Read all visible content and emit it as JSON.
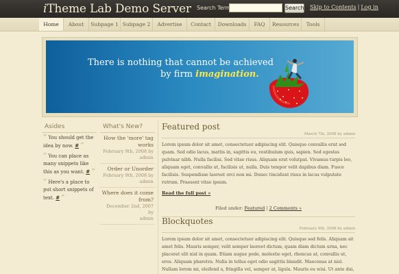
{
  "header": {
    "title_i": "i",
    "title_rest": "Theme Lab Demo Server",
    "search_label": "Search Terms:",
    "search_value": "",
    "search_button": "Search",
    "skip_link": "Skip to Contents",
    "separator": "|",
    "login_link": "Log in"
  },
  "nav": {
    "items": [
      "Home",
      "About",
      "Subpage 1",
      "Subpage 2",
      "Advertise",
      "Contact",
      "Downloads",
      "FAQ",
      "Resources",
      "Tools"
    ]
  },
  "banner": {
    "line1": "There is nothing that cannot be achieved",
    "line2_prefix": "by firm",
    "line2_highlight": "imagination."
  },
  "asides": {
    "title": "Asides",
    "items": [
      {
        "text": "You should get the idea by now.",
        "link": "#"
      },
      {
        "text": "You can place as many snippets like this as you want.",
        "link": "#"
      },
      {
        "text": "Here's a place to put short snippets of text.",
        "link": "#"
      }
    ]
  },
  "whats_new": {
    "title": "What's New?",
    "items": [
      {
        "title": "How the 'more' tag works",
        "date": "February 9th, 2008 by",
        "author": "admin"
      },
      {
        "title": "Order or Unorder",
        "date": "February 9th, 2008 by",
        "author": "admin"
      },
      {
        "title": "Where does it come from?",
        "date": "December 2nd, 2007 by",
        "author": "admin"
      }
    ]
  },
  "posts": [
    {
      "title": "Featured post",
      "date": "March 7th, 2008 by admin",
      "body": "Lorem ipsum dolor sit amet, consectetuer adipiscing elit. Quisque convallis erat sed quam. Sed odio lacus, mattis in, sagittis eu, vestibulum quis, sapien. Sed egestas pulvinar nibh. Nulla facilisi. Sed vitae risus. Aliquam erat volutpat. Vivamus turpis leo, aliquam eget, convallis ut, facilisis ut, nulla. Duis tempor velit dapibus diam. Fusce facilisis. Suspendisse laoreet orci non mi. Donec tincidunt risus in lacus vulputate rutrum. Praesent vitae ipsum.",
      "read_more": "Read the full post »",
      "filed_under": "Filed under:",
      "category": "Featured",
      "comments": "2 Comments »"
    },
    {
      "title": "Blockquotes",
      "date": "February 9th, 2008 by admin",
      "body": "Lorem ipsum dolor sit amet, consectetuer adipiscing elit. Quisque sed felis. Aliquam sit amet felis. Mauris semper, velit semper laoreet dictum, quam diam dictum urna, nec placerat elit nisl in quam. Etiam augue pede, molestie eget, rhoncus at, convallis ut, eros. Aliquam pharetra. Nulla in tellus eget odio sagittis blandit. Maecenas at nisl. Nullam lorem mi, eleifend a, fringilla vel, semper at, ligula. Mauris eu wisi. Ut ante dui, aliquet nec, congue"
    }
  ],
  "colors": {
    "header_bg": "#2f2c29",
    "page_bg": "#f4ecd2",
    "banner_blue": "#1a72ad",
    "highlight_yellow": "#ffe64a",
    "heading_brown": "#6a5a36"
  }
}
